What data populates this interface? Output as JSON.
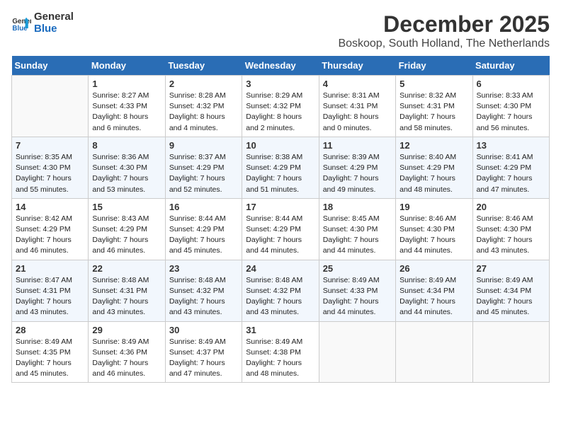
{
  "logo": {
    "line1": "General",
    "line2": "Blue"
  },
  "title": "December 2025",
  "subtitle": "Boskoop, South Holland, The Netherlands",
  "weekdays": [
    "Sunday",
    "Monday",
    "Tuesday",
    "Wednesday",
    "Thursday",
    "Friday",
    "Saturday"
  ],
  "weeks": [
    [
      {
        "day": "",
        "info": ""
      },
      {
        "day": "1",
        "info": "Sunrise: 8:27 AM\nSunset: 4:33 PM\nDaylight: 8 hours\nand 6 minutes."
      },
      {
        "day": "2",
        "info": "Sunrise: 8:28 AM\nSunset: 4:32 PM\nDaylight: 8 hours\nand 4 minutes."
      },
      {
        "day": "3",
        "info": "Sunrise: 8:29 AM\nSunset: 4:32 PM\nDaylight: 8 hours\nand 2 minutes."
      },
      {
        "day": "4",
        "info": "Sunrise: 8:31 AM\nSunset: 4:31 PM\nDaylight: 8 hours\nand 0 minutes."
      },
      {
        "day": "5",
        "info": "Sunrise: 8:32 AM\nSunset: 4:31 PM\nDaylight: 7 hours\nand 58 minutes."
      },
      {
        "day": "6",
        "info": "Sunrise: 8:33 AM\nSunset: 4:30 PM\nDaylight: 7 hours\nand 56 minutes."
      }
    ],
    [
      {
        "day": "7",
        "info": "Sunrise: 8:35 AM\nSunset: 4:30 PM\nDaylight: 7 hours\nand 55 minutes."
      },
      {
        "day": "8",
        "info": "Sunrise: 8:36 AM\nSunset: 4:30 PM\nDaylight: 7 hours\nand 53 minutes."
      },
      {
        "day": "9",
        "info": "Sunrise: 8:37 AM\nSunset: 4:29 PM\nDaylight: 7 hours\nand 52 minutes."
      },
      {
        "day": "10",
        "info": "Sunrise: 8:38 AM\nSunset: 4:29 PM\nDaylight: 7 hours\nand 51 minutes."
      },
      {
        "day": "11",
        "info": "Sunrise: 8:39 AM\nSunset: 4:29 PM\nDaylight: 7 hours\nand 49 minutes."
      },
      {
        "day": "12",
        "info": "Sunrise: 8:40 AM\nSunset: 4:29 PM\nDaylight: 7 hours\nand 48 minutes."
      },
      {
        "day": "13",
        "info": "Sunrise: 8:41 AM\nSunset: 4:29 PM\nDaylight: 7 hours\nand 47 minutes."
      }
    ],
    [
      {
        "day": "14",
        "info": "Sunrise: 8:42 AM\nSunset: 4:29 PM\nDaylight: 7 hours\nand 46 minutes."
      },
      {
        "day": "15",
        "info": "Sunrise: 8:43 AM\nSunset: 4:29 PM\nDaylight: 7 hours\nand 46 minutes."
      },
      {
        "day": "16",
        "info": "Sunrise: 8:44 AM\nSunset: 4:29 PM\nDaylight: 7 hours\nand 45 minutes."
      },
      {
        "day": "17",
        "info": "Sunrise: 8:44 AM\nSunset: 4:29 PM\nDaylight: 7 hours\nand 44 minutes."
      },
      {
        "day": "18",
        "info": "Sunrise: 8:45 AM\nSunset: 4:30 PM\nDaylight: 7 hours\nand 44 minutes."
      },
      {
        "day": "19",
        "info": "Sunrise: 8:46 AM\nSunset: 4:30 PM\nDaylight: 7 hours\nand 44 minutes."
      },
      {
        "day": "20",
        "info": "Sunrise: 8:46 AM\nSunset: 4:30 PM\nDaylight: 7 hours\nand 43 minutes."
      }
    ],
    [
      {
        "day": "21",
        "info": "Sunrise: 8:47 AM\nSunset: 4:31 PM\nDaylight: 7 hours\nand 43 minutes."
      },
      {
        "day": "22",
        "info": "Sunrise: 8:48 AM\nSunset: 4:31 PM\nDaylight: 7 hours\nand 43 minutes."
      },
      {
        "day": "23",
        "info": "Sunrise: 8:48 AM\nSunset: 4:32 PM\nDaylight: 7 hours\nand 43 minutes."
      },
      {
        "day": "24",
        "info": "Sunrise: 8:48 AM\nSunset: 4:32 PM\nDaylight: 7 hours\nand 43 minutes."
      },
      {
        "day": "25",
        "info": "Sunrise: 8:49 AM\nSunset: 4:33 PM\nDaylight: 7 hours\nand 44 minutes."
      },
      {
        "day": "26",
        "info": "Sunrise: 8:49 AM\nSunset: 4:34 PM\nDaylight: 7 hours\nand 44 minutes."
      },
      {
        "day": "27",
        "info": "Sunrise: 8:49 AM\nSunset: 4:34 PM\nDaylight: 7 hours\nand 45 minutes."
      }
    ],
    [
      {
        "day": "28",
        "info": "Sunrise: 8:49 AM\nSunset: 4:35 PM\nDaylight: 7 hours\nand 45 minutes."
      },
      {
        "day": "29",
        "info": "Sunrise: 8:49 AM\nSunset: 4:36 PM\nDaylight: 7 hours\nand 46 minutes."
      },
      {
        "day": "30",
        "info": "Sunrise: 8:49 AM\nSunset: 4:37 PM\nDaylight: 7 hours\nand 47 minutes."
      },
      {
        "day": "31",
        "info": "Sunrise: 8:49 AM\nSunset: 4:38 PM\nDaylight: 7 hours\nand 48 minutes."
      },
      {
        "day": "",
        "info": ""
      },
      {
        "day": "",
        "info": ""
      },
      {
        "day": "",
        "info": ""
      }
    ]
  ]
}
